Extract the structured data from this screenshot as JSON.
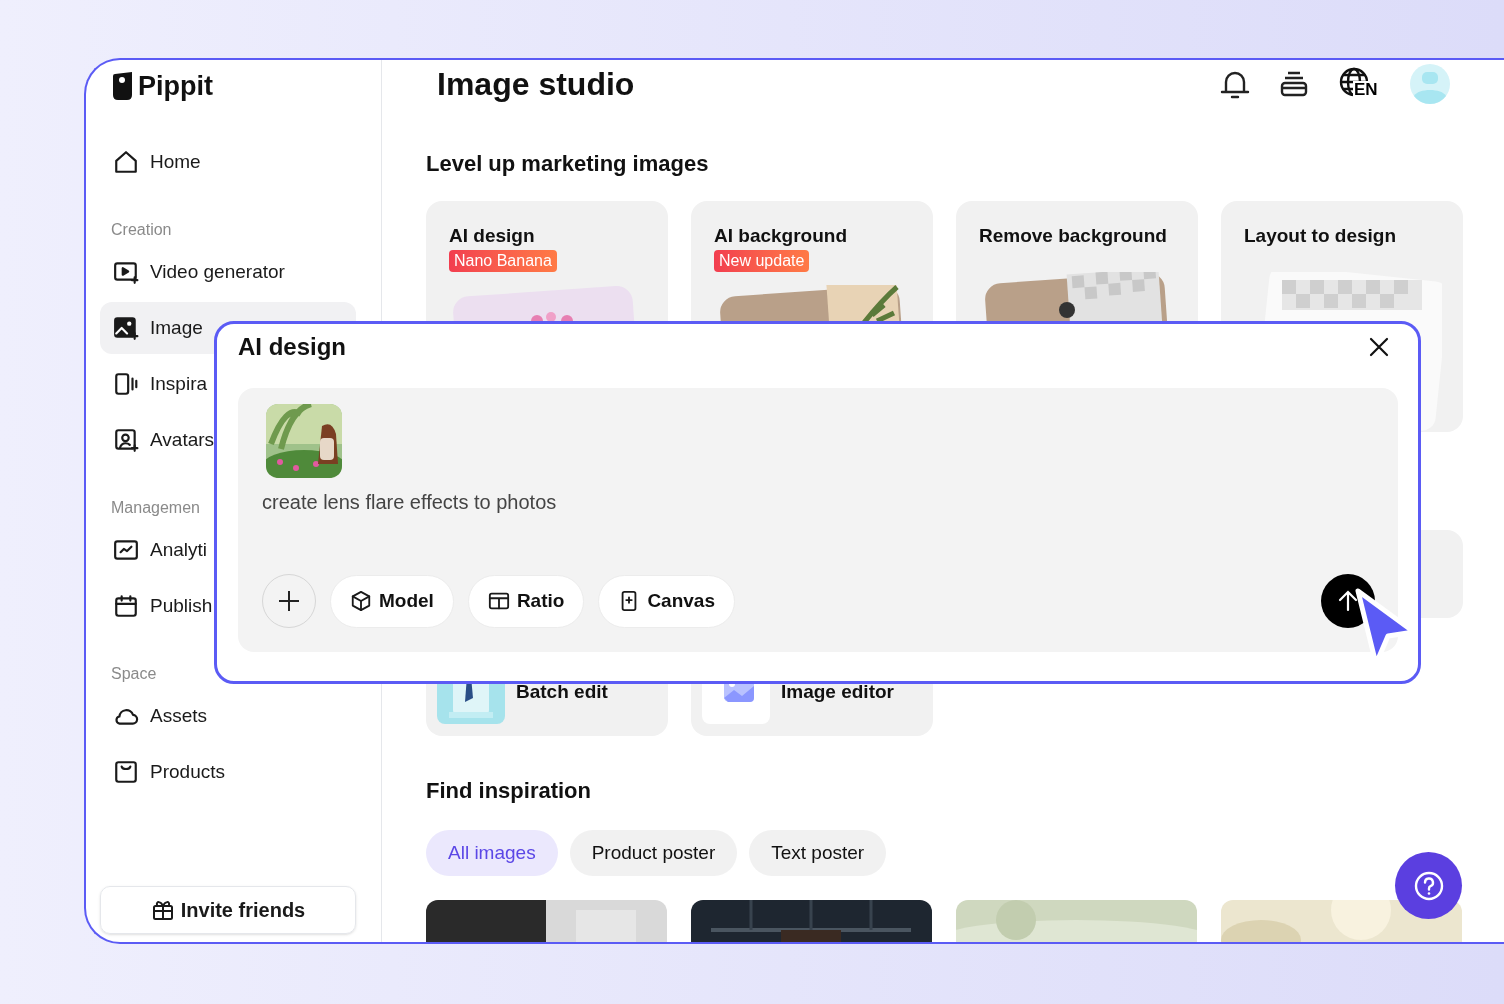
{
  "app": {
    "logo": "Pippit"
  },
  "sidebar": {
    "sections": [
      {
        "items": [
          {
            "label": "Home",
            "selected": false
          }
        ]
      },
      {
        "heading": "Creation",
        "items": [
          {
            "label": "Video generator",
            "selected": false
          },
          {
            "label": "Image",
            "selected": true
          },
          {
            "label": "Inspira",
            "selected": false
          },
          {
            "label": "Avatars",
            "selected": false
          }
        ]
      },
      {
        "heading": "Managemen",
        "items": [
          {
            "label": "Analyti",
            "selected": false
          },
          {
            "label": "Publish",
            "selected": false
          }
        ]
      },
      {
        "heading": "Space",
        "items": [
          {
            "label": "Assets",
            "selected": false
          },
          {
            "label": "Products",
            "selected": false
          }
        ]
      }
    ],
    "invite_button": "Invite friends"
  },
  "header": {
    "title": "Image studio",
    "language": "EN"
  },
  "marketing": {
    "heading": "Level up marketing images",
    "cards": [
      {
        "title": "AI design",
        "badge": "Nano Banana"
      },
      {
        "title": "AI background",
        "badge": "New update"
      },
      {
        "title": "Remove background"
      },
      {
        "title": "Layout to design"
      }
    ],
    "tools": [
      {
        "title": "Batch edit"
      },
      {
        "title": "Image editor"
      }
    ]
  },
  "inspiration": {
    "heading": "Find inspiration",
    "filters": [
      {
        "label": "All images",
        "selected": true
      },
      {
        "label": "Product poster",
        "selected": false
      },
      {
        "label": "Text poster",
        "selected": false
      }
    ]
  },
  "dialog": {
    "title": "AI design",
    "prompt": "create lens flare effects to photos",
    "options": [
      "Model",
      "Ratio",
      "Canvas"
    ]
  }
}
